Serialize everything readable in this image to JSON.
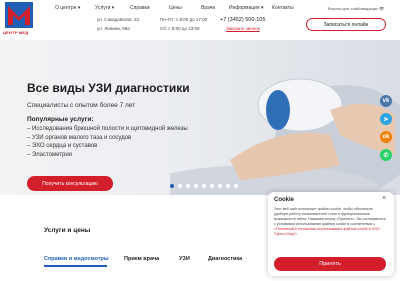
{
  "header": {
    "logo_text": "ЦЕНТР МЕД",
    "nav": [
      "О центре",
      "Услуги",
      "Справки",
      "Цены",
      "Врачи",
      "Информация",
      "Контакты"
    ],
    "addresses": [
      {
        "address": "ул. Сакадовская, 23",
        "hours": "Пн–Пт: с 8:00 до 17:00"
      },
      {
        "address": "ул. Ленина, 69а",
        "hours": "Сб: с 8:00 до 13:00"
      }
    ],
    "phone": "+7 (3452) 500-105",
    "callback": "Заказать звонок",
    "signup": "Записаться онлайн",
    "vision": "Версия для слабовидящих"
  },
  "hero": {
    "title": "Все виды УЗИ диагностики",
    "subtitle": "Специалисты с опытом более 7 лет",
    "list_title": "Популярные услуги:",
    "list": [
      "– Исследования брюшной полости и щитовидной железы",
      "– УЗИ органов малого таза и сосудов",
      "– ЭХО сердца и суставов",
      "– Эластометрия"
    ],
    "button": "Получить консультацию",
    "slides_total": 9,
    "active_slide": 1
  },
  "social": [
    {
      "icon": "vk-icon",
      "glyph": "vk",
      "color": "#4a76a8"
    },
    {
      "icon": "telegram-icon",
      "glyph": "➤",
      "color": "#2ca5e0"
    },
    {
      "icon": "odnoklassniki-icon",
      "glyph": "ok",
      "color": "#ee8208"
    },
    {
      "icon": "whatsapp-icon",
      "glyph": "✆",
      "color": "#25d366"
    }
  ],
  "services": {
    "title": "Услуги и цены",
    "tabs": [
      "Справки и медосмотры",
      "Прием врача",
      "УЗИ",
      "Диагностика"
    ],
    "active_tab": 0
  },
  "cookie": {
    "title": "Cookie",
    "close": "×",
    "text": "Этот веб-сайт использует файлы cookie, чтобы обеспечить удобную работу пользователей с ним и функциональные возможности сайта. Нажимая кнопку «Принять», Вы соглашаетесь с условиями использования файлов cookie в соответствии с ",
    "link": "«Политикой в отношении использования файлов cookie в ООО \"Центр Мед\"».",
    "accept": "Принять"
  },
  "colors": {
    "accent": "#d21f2b",
    "blue": "#1f5fb5"
  }
}
